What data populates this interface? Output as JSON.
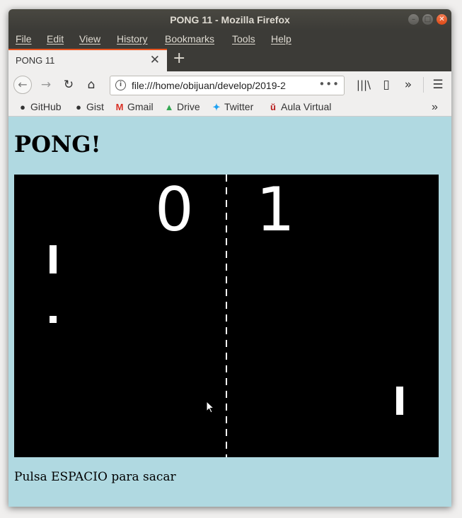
{
  "window": {
    "title": "PONG 11 - Mozilla Firefox"
  },
  "menu": {
    "items": [
      "File",
      "Edit",
      "View",
      "History",
      "Bookmarks",
      "Tools",
      "Help"
    ]
  },
  "tab": {
    "title": "PONG 11"
  },
  "navbar": {
    "url": "file:///home/obijuan/develop/2019-2"
  },
  "bookmarks": {
    "items": [
      "GitHub",
      "Gist",
      "Gmail",
      "Drive",
      "Twitter",
      "Aula Virtual"
    ]
  },
  "page": {
    "title": "PONG!",
    "score_left": "0",
    "score_right": "1",
    "instructions": "Pulsa ESPACIO para sacar"
  },
  "colors": {
    "page_background": "#b0d9e1",
    "canvas": "#000000",
    "game_elements": "#ffffff",
    "tab_accent": "#e95420"
  },
  "icons": [
    "info-icon",
    "github-icon",
    "gist-icon",
    "gmail-icon",
    "drive-icon",
    "twitter-icon",
    "aula-virtual-icon",
    "library-icon",
    "sidebar-icon",
    "overflow-chevron-icon",
    "hamburger-menu-icon",
    "mouse-cursor-icon"
  ]
}
